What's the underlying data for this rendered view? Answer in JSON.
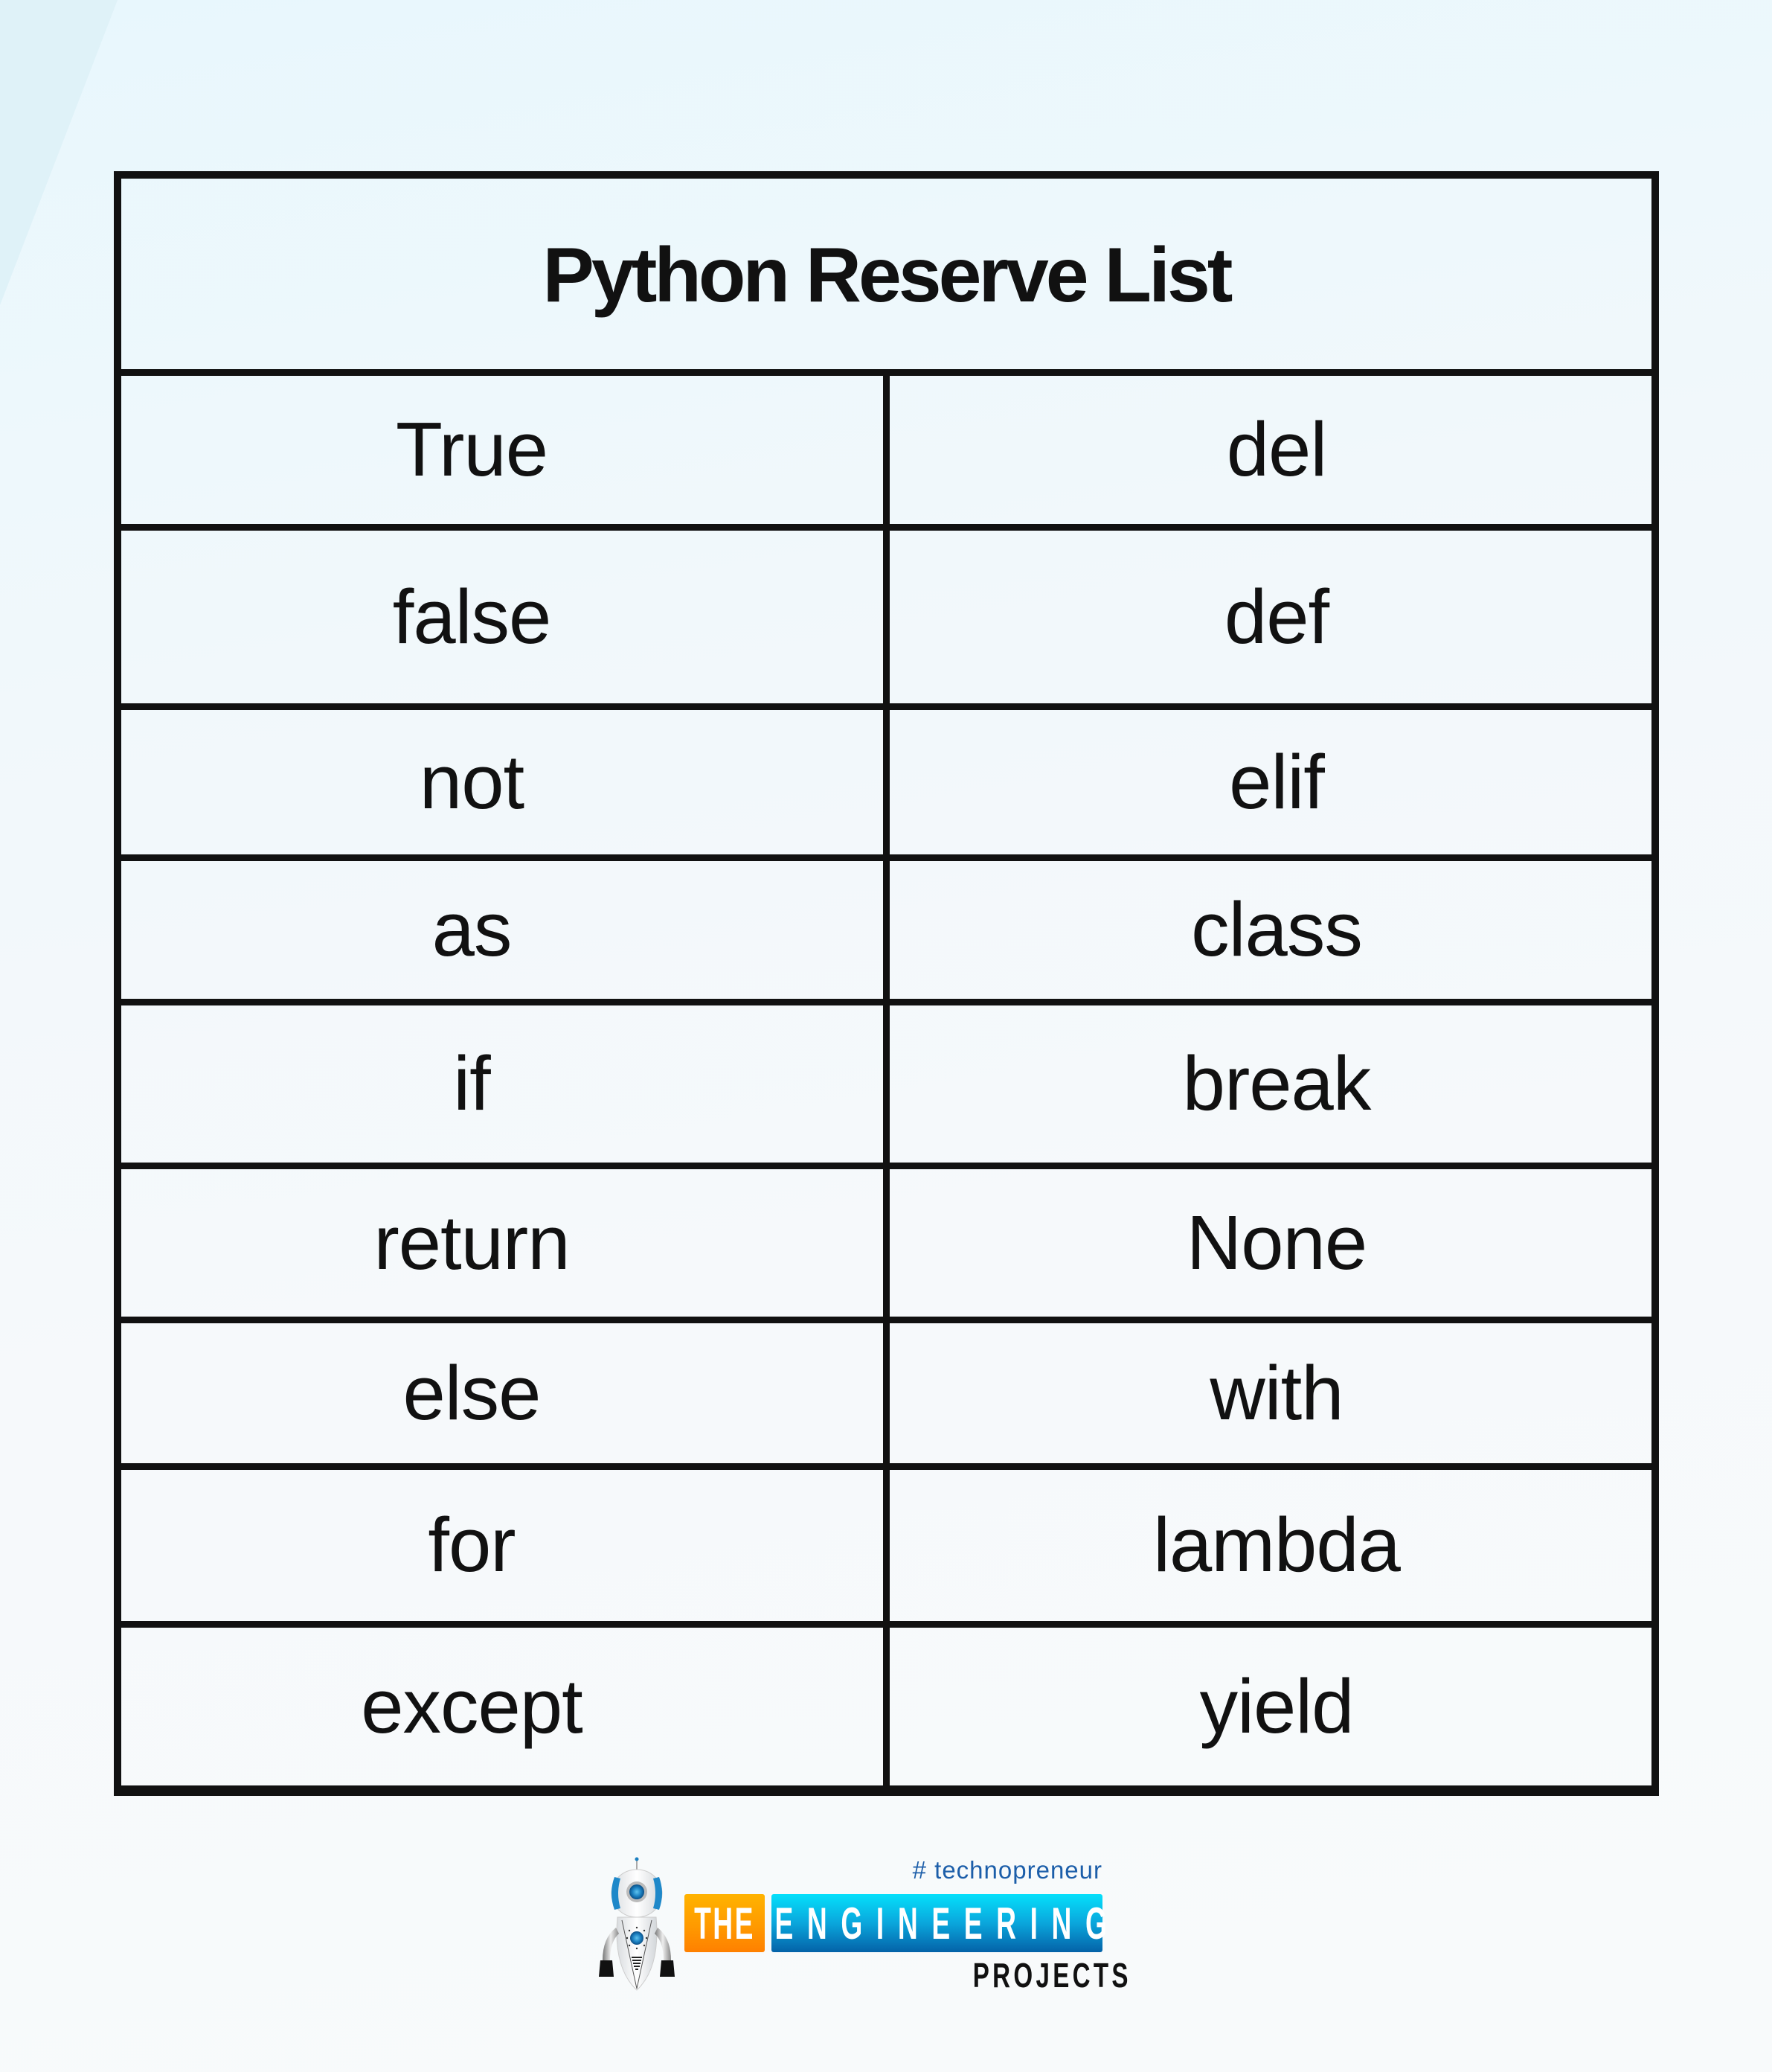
{
  "table": {
    "title": "Python Reserve List",
    "rows": [
      [
        "True",
        "del"
      ],
      [
        "false",
        "def"
      ],
      [
        "not",
        "elif"
      ],
      [
        "as",
        "class"
      ],
      [
        "if",
        "break"
      ],
      [
        "return",
        "None"
      ],
      [
        "else",
        "with"
      ],
      [
        "for",
        "lambda"
      ],
      [
        "except",
        "yield"
      ]
    ]
  },
  "logo": {
    "tagline": "# technopreneur",
    "word_the": "THE",
    "word_engineering": "ENGINEERING",
    "word_projects": "PROJECTS",
    "icon": "robot-mascot-icon",
    "colors": {
      "orange": "#ff9a00",
      "blue": "#0aa6dc",
      "tagline": "#1c5ea9"
    }
  }
}
